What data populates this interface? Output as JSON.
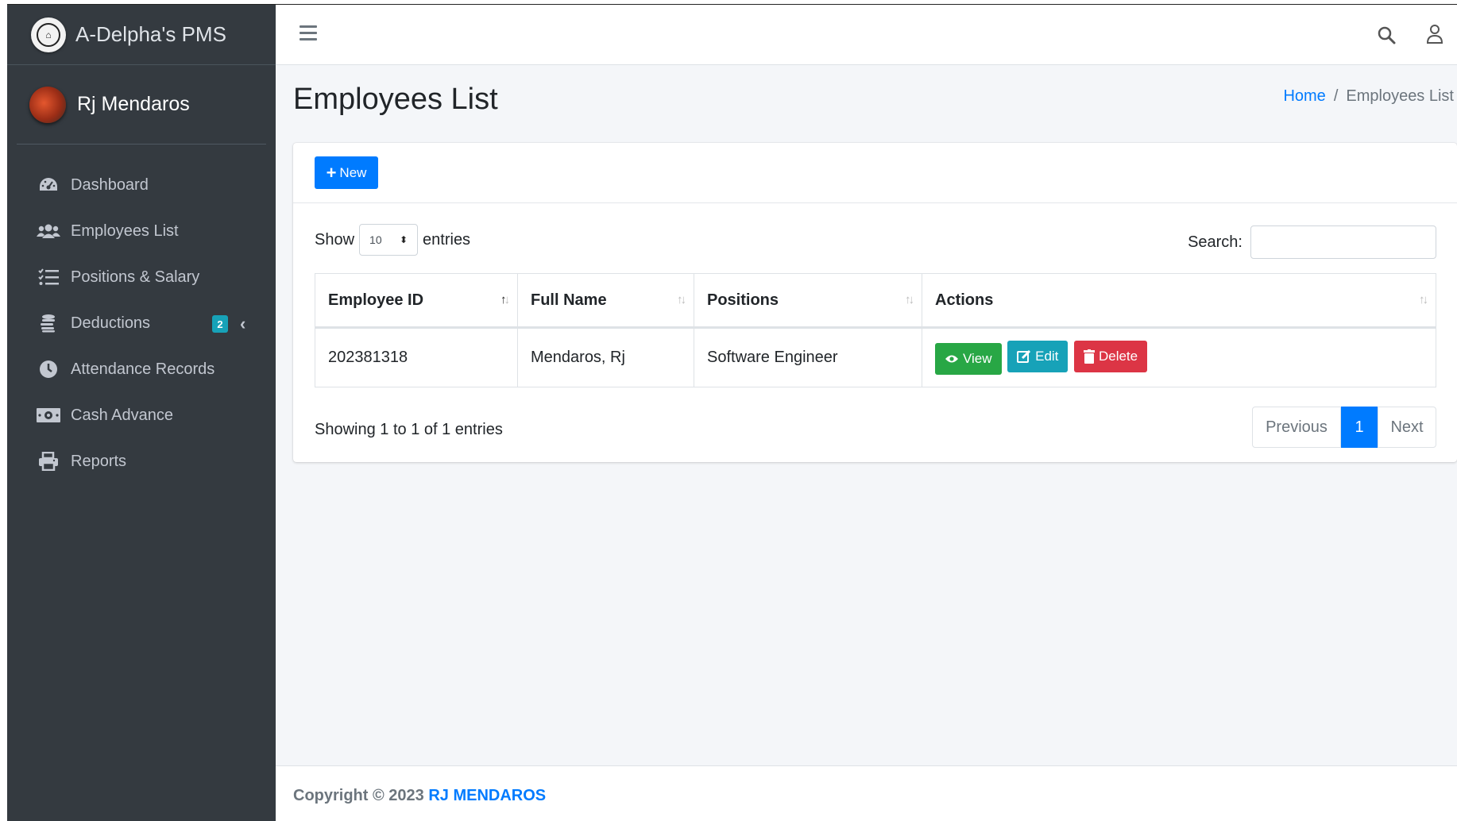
{
  "app": {
    "brand_name": "A-Delpha's PMS",
    "user_name": "Rj Mendaros"
  },
  "sidebar": {
    "items": [
      {
        "label": "Dashboard",
        "icon": "dashboard-icon"
      },
      {
        "label": "Employees List",
        "icon": "users-icon"
      },
      {
        "label": "Positions & Salary",
        "icon": "list-check-icon"
      },
      {
        "label": "Deductions",
        "icon": "coins-icon",
        "badge": "2"
      },
      {
        "label": "Attendance Records",
        "icon": "clock-icon"
      },
      {
        "label": "Cash Advance",
        "icon": "money-bill-icon"
      },
      {
        "label": "Reports",
        "icon": "print-icon"
      }
    ]
  },
  "page": {
    "title": "Employees List",
    "breadcrumb": {
      "home": "Home",
      "sep": "/",
      "current": "Employees List"
    }
  },
  "card": {
    "new_button": "New"
  },
  "table_controls": {
    "show_label": "Show",
    "entries_value": "10",
    "entries_label": "entries",
    "search_label": "Search:",
    "search_value": ""
  },
  "table": {
    "columns": [
      "Employee ID",
      "Full Name",
      "Positions",
      "Actions"
    ],
    "rows": [
      {
        "employee_id": "202381318",
        "full_name": "Mendaros, Rj",
        "position": "Software Engineer"
      }
    ],
    "actions": {
      "view": "View",
      "edit": "Edit",
      "delete": "Delete"
    }
  },
  "pagination": {
    "info": "Showing 1 to 1 of 1 entries",
    "previous": "Previous",
    "current": "1",
    "next": "Next"
  },
  "footer": {
    "prefix": "Copyright © 2023",
    "brand": "RJ MENDAROS"
  },
  "colors": {
    "sidebar_bg": "#343a40",
    "primary": "#007bff",
    "success": "#28a745",
    "info": "#17a2b8",
    "danger": "#dc3545"
  }
}
